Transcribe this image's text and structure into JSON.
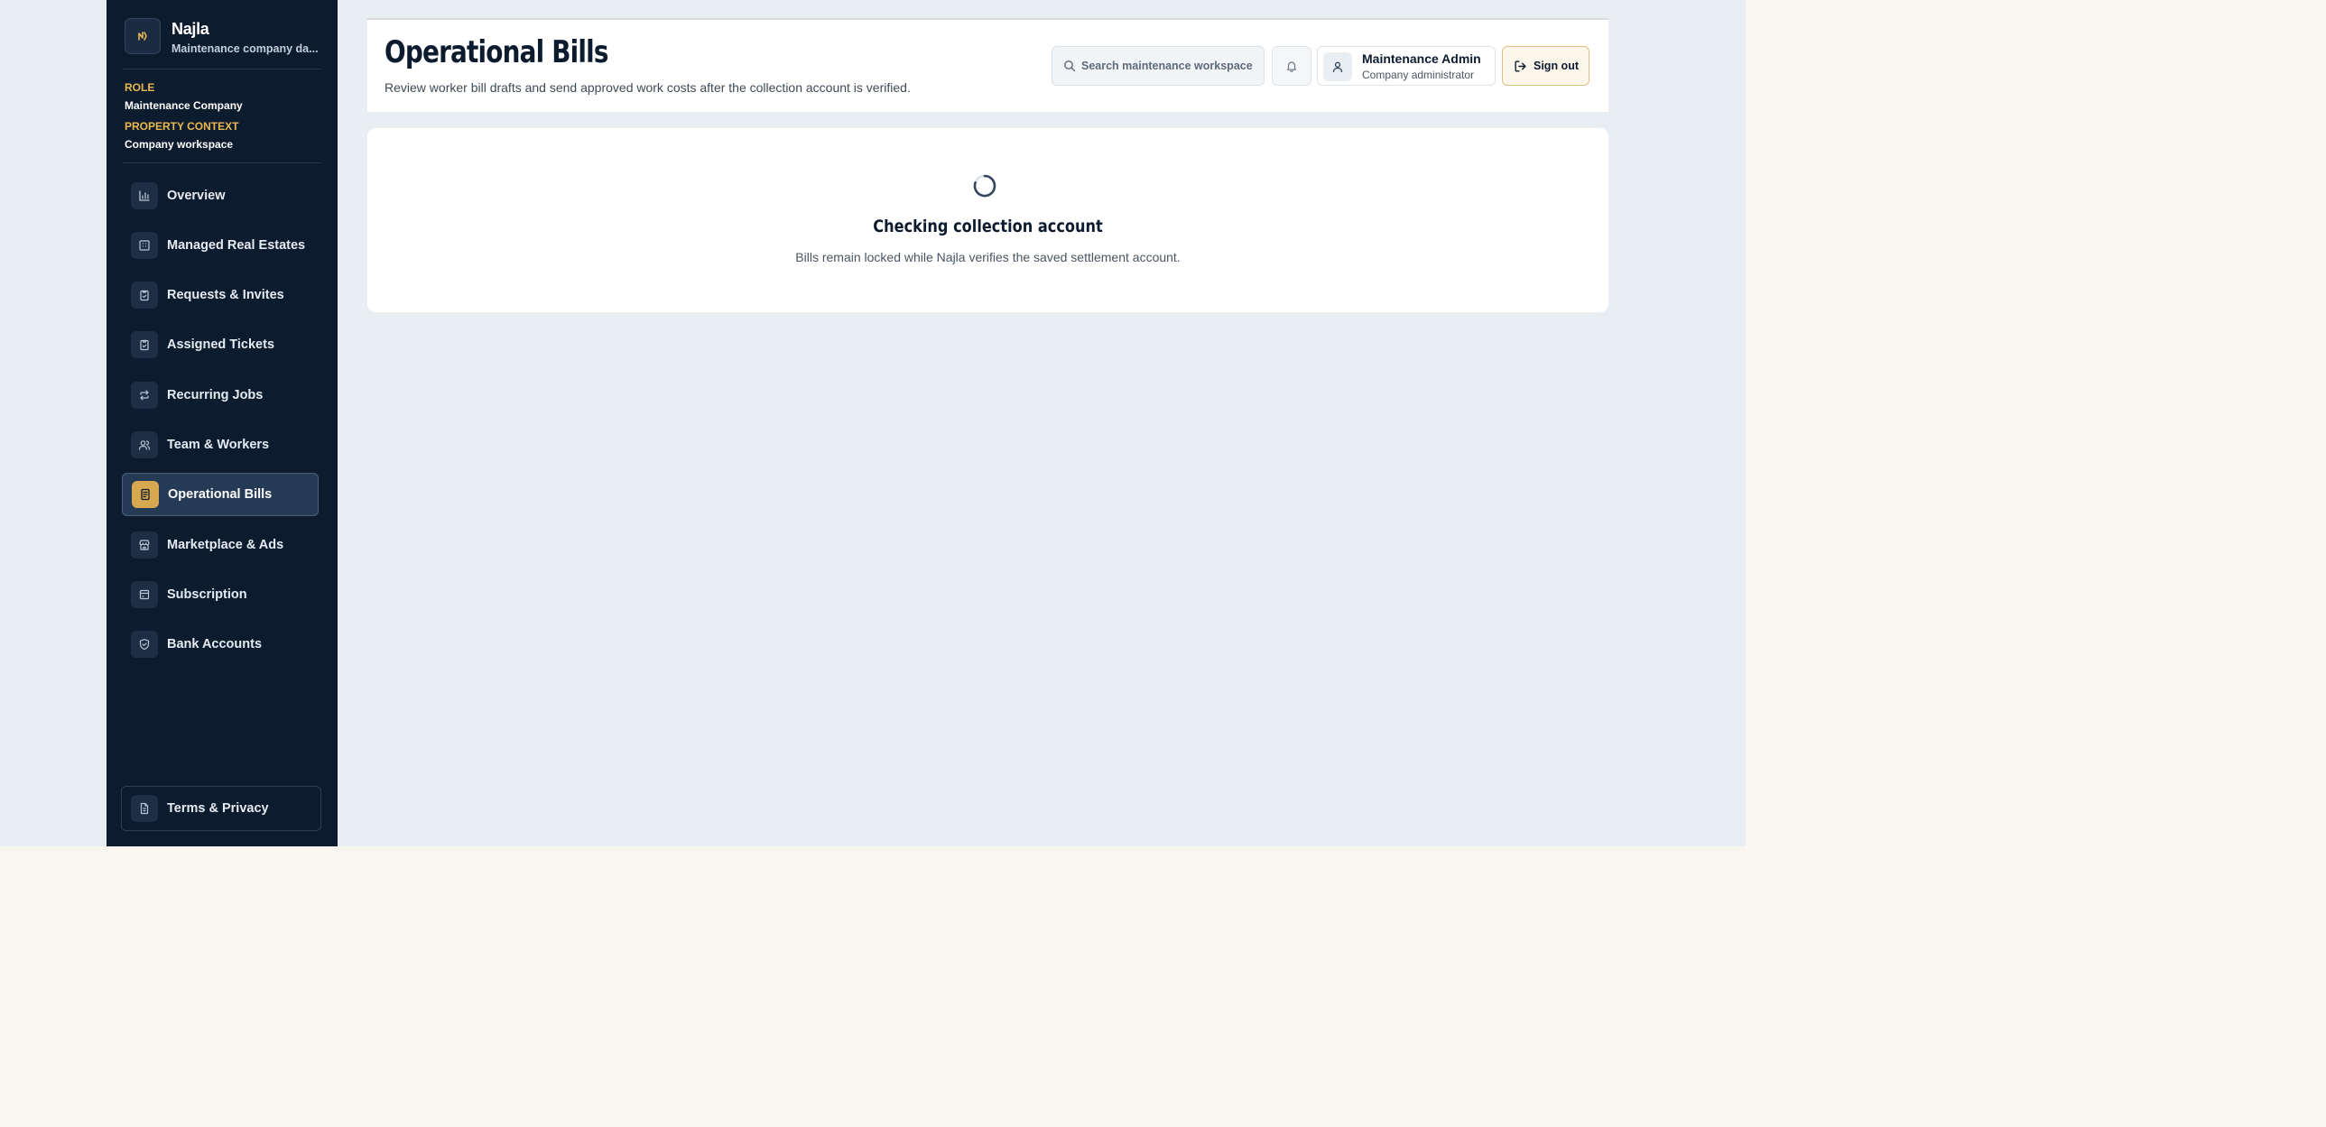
{
  "sidebar": {
    "brand": {
      "name": "Najla",
      "subtitle": "Maintenance company da..."
    },
    "role_label": "ROLE",
    "role_value": "Maintenance Company",
    "context_label": "PROPERTY CONTEXT",
    "context_value": "Company workspace",
    "items": [
      {
        "label": "Overview",
        "icon": "bar-chart-icon",
        "active": false
      },
      {
        "label": "Managed Real Estates",
        "icon": "building-icon",
        "active": false
      },
      {
        "label": "Requests & Invites",
        "icon": "clipboard-check-icon",
        "active": false
      },
      {
        "label": "Assigned Tickets",
        "icon": "clipboard-check-icon",
        "active": false
      },
      {
        "label": "Recurring Jobs",
        "icon": "repeat-icon",
        "active": false
      },
      {
        "label": "Team & Workers",
        "icon": "users-icon",
        "active": false
      },
      {
        "label": "Operational Bills",
        "icon": "receipt-icon",
        "active": true
      },
      {
        "label": "Marketplace & Ads",
        "icon": "store-icon",
        "active": false
      },
      {
        "label": "Subscription",
        "icon": "credit-card-icon",
        "active": false
      },
      {
        "label": "Bank Accounts",
        "icon": "shield-check-icon",
        "active": false
      }
    ],
    "footer_item": {
      "label": "Terms & Privacy",
      "icon": "document-icon"
    }
  },
  "header": {
    "title": "Operational Bills",
    "subtitle": "Review worker bill drafts and send approved work costs after the collection account is verified.",
    "search_placeholder": "Search maintenance workspace",
    "user_name": "Maintenance Admin",
    "user_role": "Company administrator",
    "signout_label": "Sign out"
  },
  "status": {
    "title": "Checking collection account",
    "description": "Bills remain locked while Najla verifies the saved settlement account."
  },
  "colors": {
    "sidebar_bg": "#0d1b2f",
    "accent_gold": "#d7a84f",
    "page_bg": "#e9eef2"
  }
}
